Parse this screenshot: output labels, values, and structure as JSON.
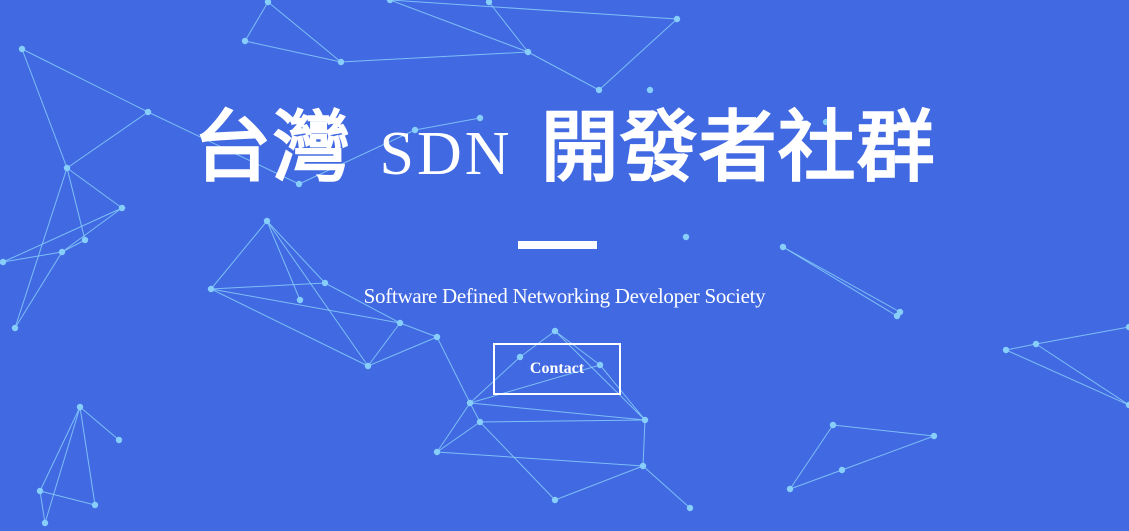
{
  "colors": {
    "background": "#4169e1",
    "node": "#87cefa",
    "link": "#87cefa",
    "text": "#ffffff"
  },
  "hero": {
    "title_zh_left": "台灣",
    "title_latin": "SDN",
    "title_zh_right": "開發者社群",
    "subtitle": "Software Defined Networking Developer Society",
    "contact_label": "Contact"
  }
}
